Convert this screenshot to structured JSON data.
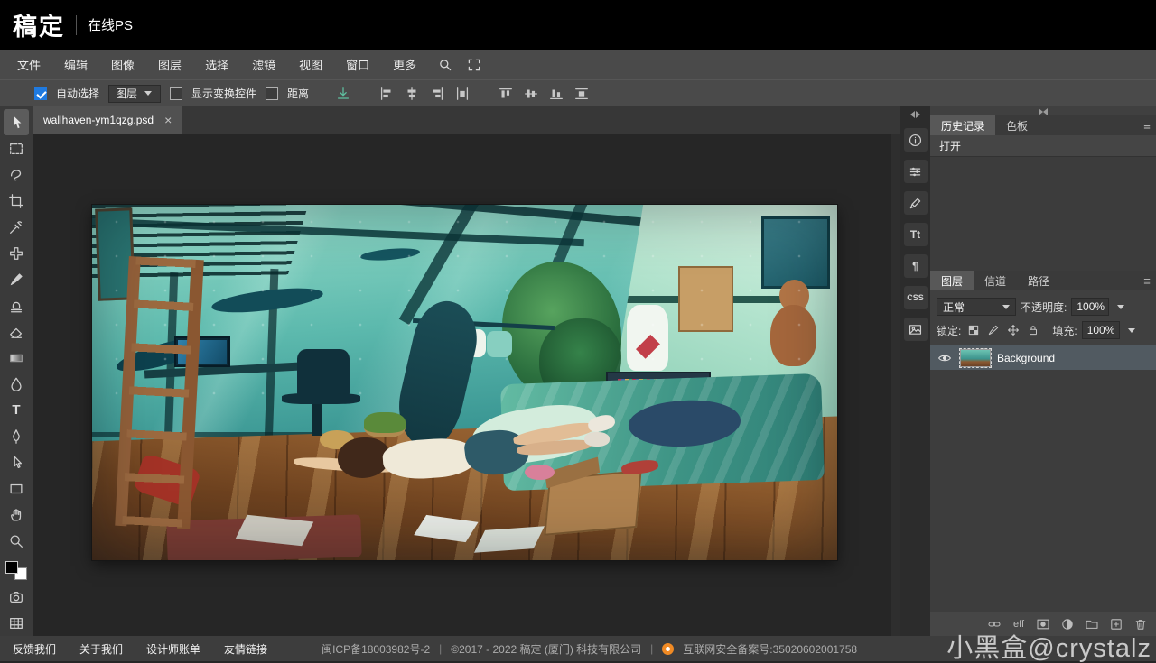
{
  "header": {
    "logo": "稿定",
    "product": "在线PS"
  },
  "menubar": {
    "items": [
      "文件",
      "编辑",
      "图像",
      "图层",
      "选择",
      "滤镜",
      "视图",
      "窗口",
      "更多"
    ]
  },
  "optionsbar": {
    "auto_select_label": "自动选择",
    "target_value": "图层",
    "show_transform_label": "显示变换控件",
    "distance_label": "距离"
  },
  "tabbar": {
    "document_title": "wallhaven-ym1qzg.psd",
    "close_glyph": "×"
  },
  "right_strip": {
    "text_tool_label": "Tt",
    "paragraph_label": "¶",
    "css_label": "CSS"
  },
  "history_panel": {
    "tab_history": "历史记录",
    "tab_swatches": "色板",
    "entry_open": "打开",
    "menu_glyph": "≡"
  },
  "layers_panel": {
    "tab_layers": "图层",
    "tab_channels": "信道",
    "tab_paths": "路径",
    "menu_glyph": "≡",
    "blend_mode_value": "正常",
    "opacity_label": "不透明度:",
    "opacity_value": "100%",
    "lock_label": "锁定:",
    "fill_label": "填充:",
    "fill_value": "100%",
    "layer_name": "Background",
    "effects_label": "eff"
  },
  "tools": {
    "type_glyph": "T"
  },
  "footer": {
    "links": [
      "反馈我们",
      "关于我们",
      "设计师账单",
      "友情链接"
    ],
    "icp": "闽ICP备18003982号-2",
    "divider": "|",
    "copyright": "©2017 - 2022 稿定 (厦门) 科技有限公司",
    "security": "互联网安全备案号:35020602001758"
  },
  "watermark": "小黑盒@crystalz"
}
